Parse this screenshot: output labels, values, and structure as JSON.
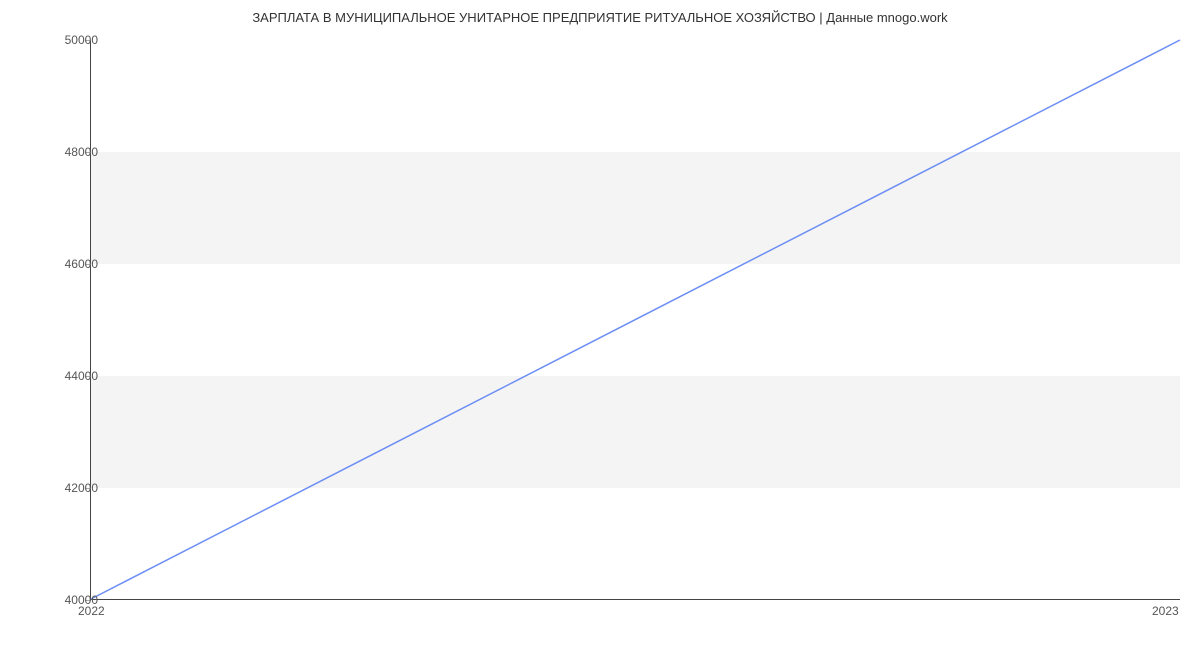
{
  "chart_data": {
    "type": "line",
    "title": "ЗАРПЛАТА В МУНИЦИПАЛЬНОЕ УНИТАРНОЕ ПРЕДПРИЯТИЕ РИТУАЛЬНОЕ ХОЗЯЙСТВО | Данные mnogo.work",
    "x": [
      "2022",
      "2023"
    ],
    "values": [
      40000,
      50000
    ],
    "xlabel": "",
    "ylabel": "",
    "ylim": [
      40000,
      50000
    ],
    "yticks": [
      40000,
      42000,
      44000,
      46000,
      48000,
      50000
    ],
    "xticks": [
      "2022",
      "2023"
    ],
    "line_color": "#6c8ef5"
  }
}
